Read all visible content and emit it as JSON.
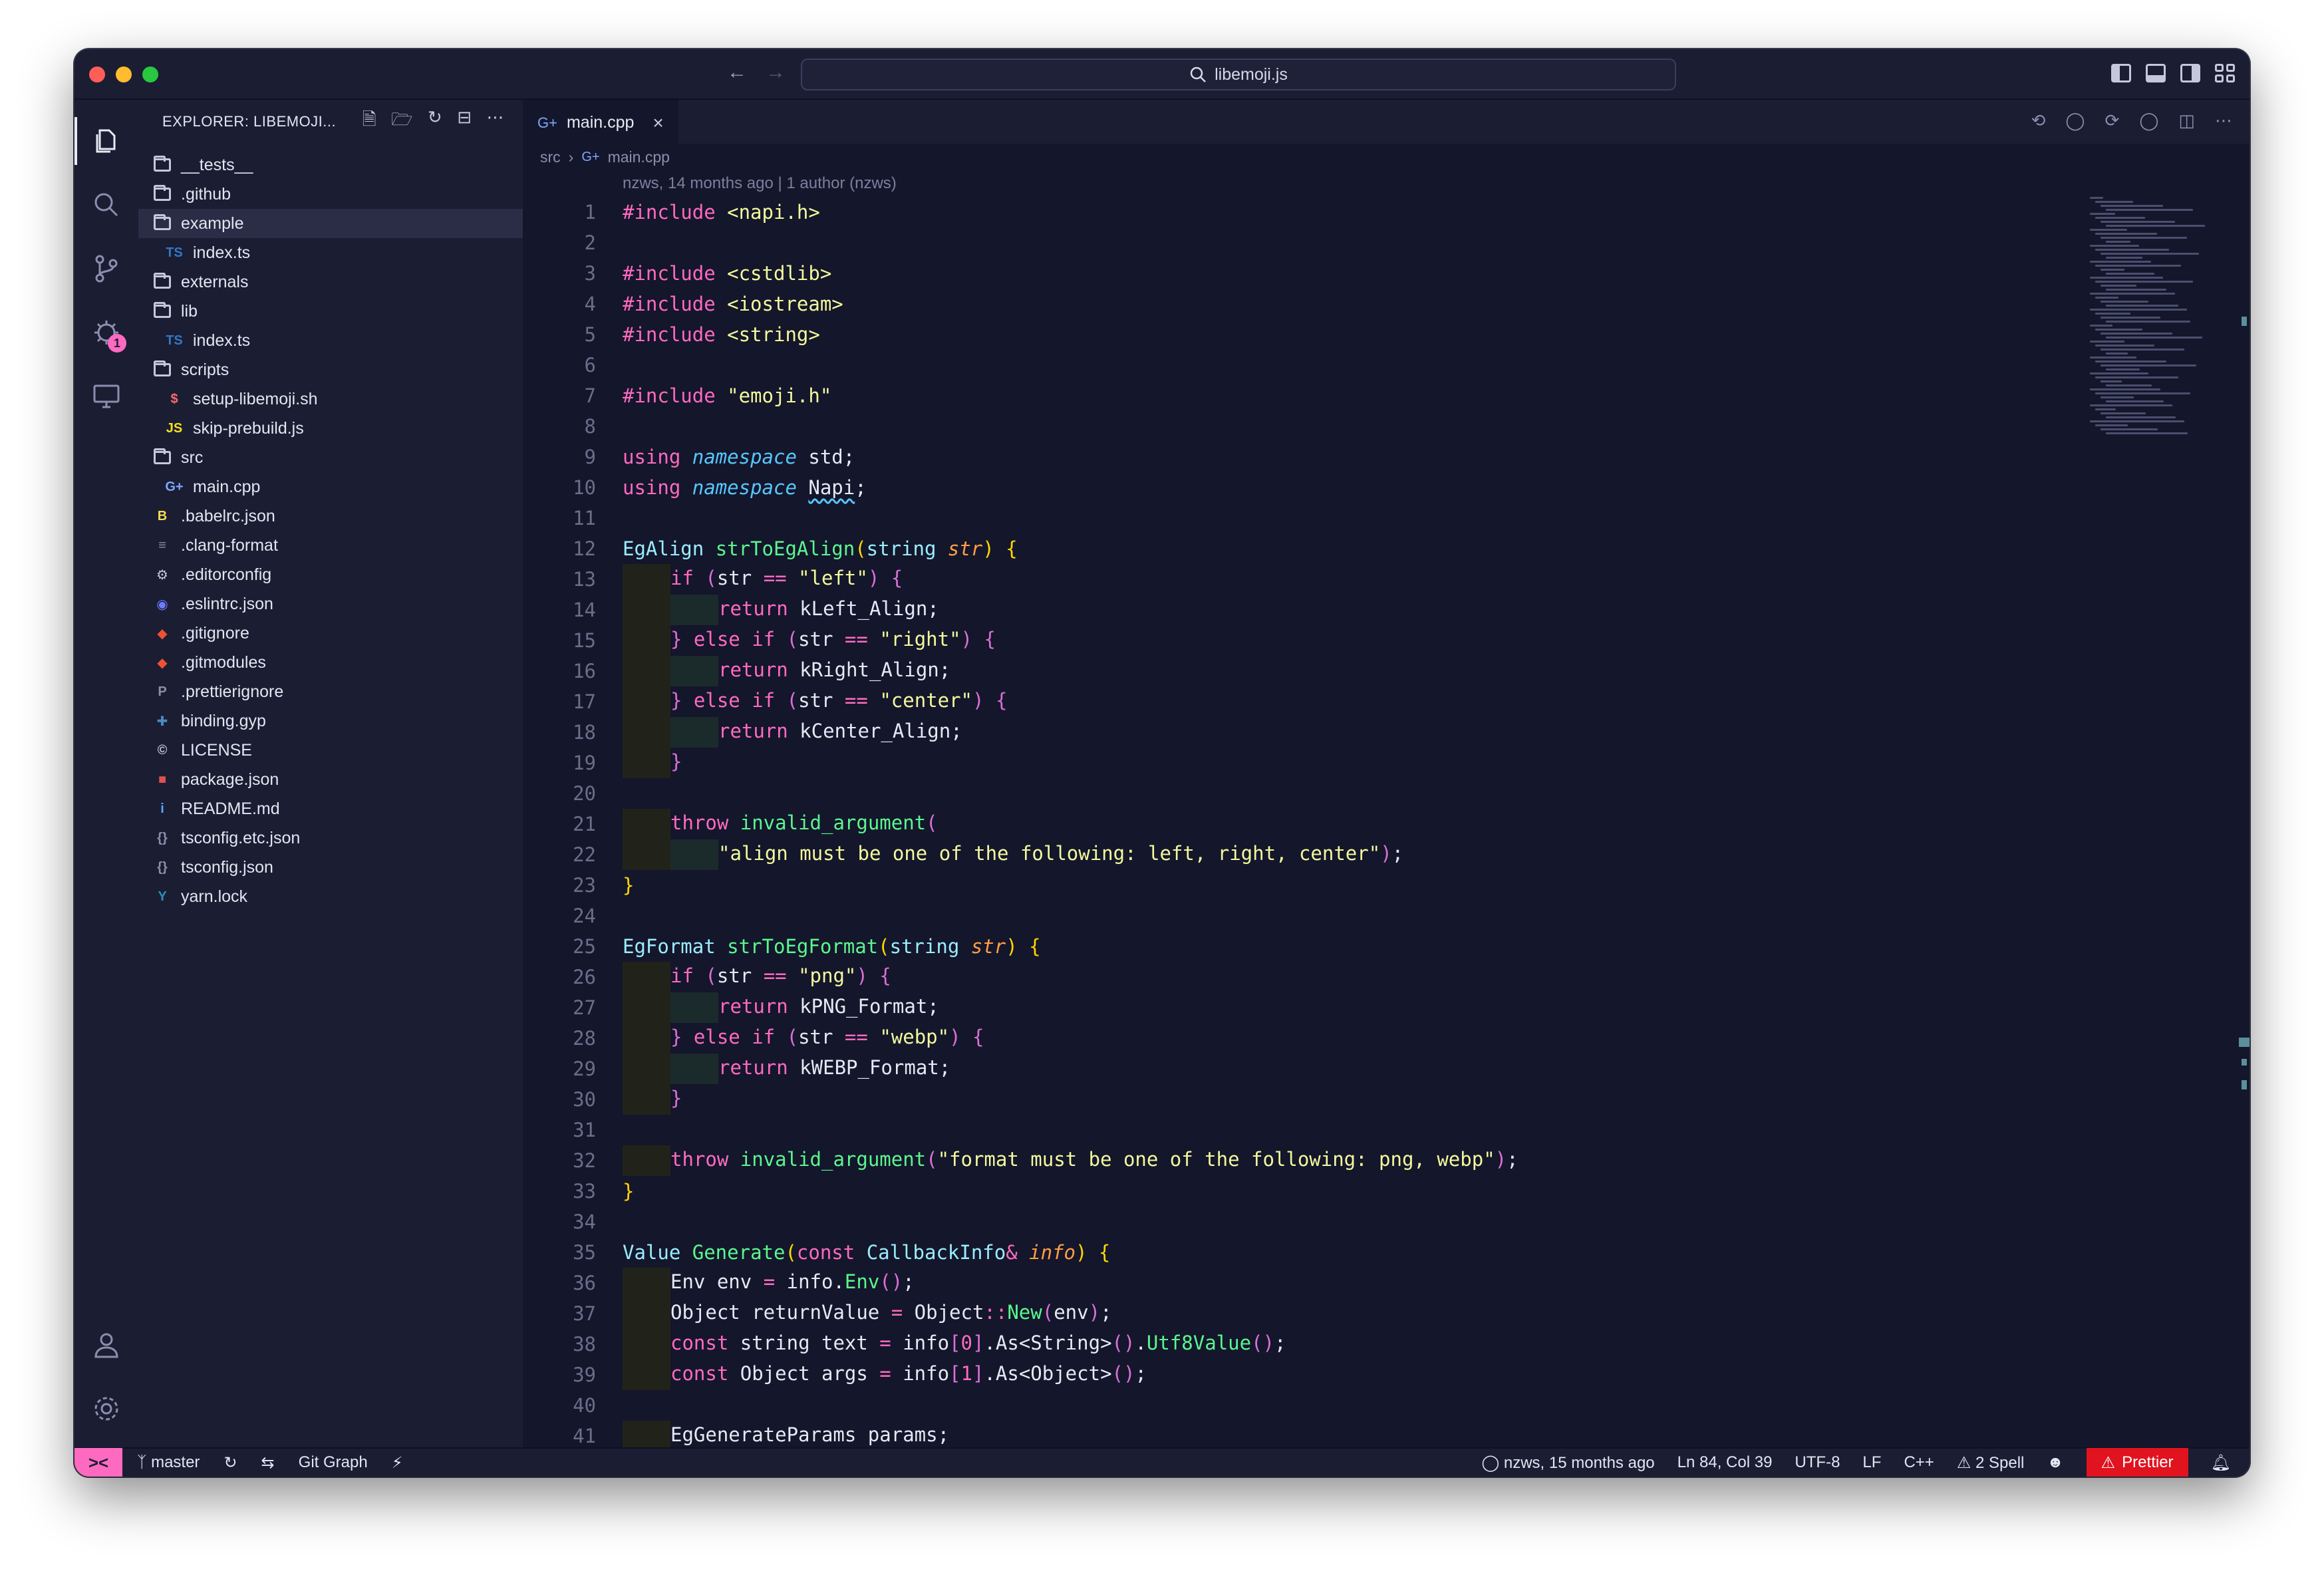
{
  "window": {
    "search_text": "libemoji.js"
  },
  "activity": {
    "extensions_badge": "1"
  },
  "sidebar": {
    "title": "EXPLORER: LIBEMOJI...",
    "tree": [
      {
        "label": "__tests__",
        "icon": "folder-tests-icon",
        "kind": "folder",
        "level": 0
      },
      {
        "label": ".github",
        "icon": "folder-github-icon",
        "kind": "folder",
        "level": 0
      },
      {
        "label": "example",
        "icon": "folder-icon",
        "kind": "folder",
        "level": 0,
        "selected": true
      },
      {
        "label": "index.ts",
        "icon": "typescript-icon",
        "kind": "file",
        "level": 1
      },
      {
        "label": "externals",
        "icon": "folder-icon",
        "kind": "folder",
        "level": 0
      },
      {
        "label": "lib",
        "icon": "folder-icon",
        "kind": "folder",
        "level": 0
      },
      {
        "label": "index.ts",
        "icon": "typescript-icon",
        "kind": "file",
        "level": 1
      },
      {
        "label": "scripts",
        "icon": "folder-icon",
        "kind": "folder",
        "level": 0
      },
      {
        "label": "setup-libemoji.sh",
        "icon": "shell-icon",
        "kind": "file",
        "level": 1
      },
      {
        "label": "skip-prebuild.js",
        "icon": "javascript-icon",
        "kind": "file",
        "level": 1
      },
      {
        "label": "src",
        "icon": "folder-src-icon",
        "kind": "folder",
        "level": 0
      },
      {
        "label": "main.cpp",
        "icon": "cpp-icon",
        "kind": "file",
        "level": 1
      },
      {
        "label": ".babelrc.json",
        "icon": "babel-icon",
        "kind": "file",
        "level": 0
      },
      {
        "label": ".clang-format",
        "icon": "clang-icon",
        "kind": "file",
        "level": 0
      },
      {
        "label": ".editorconfig",
        "icon": "editorconfig-icon",
        "kind": "file",
        "level": 0
      },
      {
        "label": ".eslintrc.json",
        "icon": "eslint-icon",
        "kind": "file",
        "level": 0
      },
      {
        "label": ".gitignore",
        "icon": "git-icon",
        "kind": "file",
        "level": 0
      },
      {
        "label": ".gitmodules",
        "icon": "git-icon",
        "kind": "file",
        "level": 0
      },
      {
        "label": ".prettierignore",
        "icon": "prettier-icon",
        "kind": "file",
        "level": 0
      },
      {
        "label": "binding.gyp",
        "icon": "python-icon",
        "kind": "file",
        "level": 0
      },
      {
        "label": "LICENSE",
        "icon": "license-icon",
        "kind": "file",
        "level": 0
      },
      {
        "label": "package.json",
        "icon": "npm-icon",
        "kind": "file",
        "level": 0
      },
      {
        "label": "README.md",
        "icon": "info-icon",
        "kind": "file",
        "level": 0
      },
      {
        "label": "tsconfig.etc.json",
        "icon": "json-icon",
        "kind": "file",
        "level": 0
      },
      {
        "label": "tsconfig.json",
        "icon": "json-icon",
        "kind": "file",
        "level": 0
      },
      {
        "label": "yarn.lock",
        "icon": "yarn-icon",
        "kind": "file",
        "level": 0
      }
    ]
  },
  "editor": {
    "tab_label": "main.cpp",
    "breadcrumb": [
      "src",
      "main.cpp"
    ],
    "blame": "nzws, 14 months ago | 1 author (nzws)",
    "lines": [
      {
        "n": "1",
        "indent": 0,
        "tokens": [
          [
            "k",
            "#include "
          ],
          [
            "s",
            "<napi.h>"
          ]
        ]
      },
      {
        "n": "2",
        "indent": 0,
        "tokens": []
      },
      {
        "n": "3",
        "indent": 0,
        "tokens": [
          [
            "k",
            "#include "
          ],
          [
            "s",
            "<cstdlib>"
          ]
        ]
      },
      {
        "n": "4",
        "indent": 0,
        "tokens": [
          [
            "k",
            "#include "
          ],
          [
            "s",
            "<iostream>"
          ]
        ]
      },
      {
        "n": "5",
        "indent": 0,
        "tokens": [
          [
            "k",
            "#include "
          ],
          [
            "s",
            "<string>"
          ]
        ]
      },
      {
        "n": "6",
        "indent": 0,
        "tokens": []
      },
      {
        "n": "7",
        "indent": 0,
        "tokens": [
          [
            "k",
            "#include "
          ],
          [
            "s",
            "\"emoji.h\""
          ]
        ]
      },
      {
        "n": "8",
        "indent": 0,
        "tokens": []
      },
      {
        "n": "9",
        "indent": 0,
        "tokens": [
          [
            "k",
            "using "
          ],
          [
            "it",
            "namespace"
          ],
          [
            "p",
            " std;"
          ]
        ]
      },
      {
        "n": "10",
        "indent": 0,
        "tokens": [
          [
            "k",
            "using "
          ],
          [
            "it",
            "namespace"
          ],
          [
            "p",
            " "
          ],
          [
            "u",
            "Napi"
          ],
          [
            "p",
            ";"
          ]
        ]
      },
      {
        "n": "11",
        "indent": 0,
        "tokens": []
      },
      {
        "n": "12",
        "indent": 0,
        "tokens": [
          [
            "t",
            "EgAlign "
          ],
          [
            "f",
            "strToEgAlign"
          ],
          [
            "br1",
            "("
          ],
          [
            "t",
            "string "
          ],
          [
            "pa",
            "str"
          ],
          [
            "br1",
            ")"
          ],
          [
            "p",
            " "
          ],
          [
            "br1",
            "{"
          ]
        ]
      },
      {
        "n": "13",
        "indent": 1,
        "tokens": [
          [
            "k",
            "if "
          ],
          [
            "br2",
            "("
          ],
          [
            "p",
            "str "
          ],
          [
            "k",
            "=="
          ],
          [
            "p",
            " "
          ],
          [
            "s",
            "\"left\""
          ],
          [
            "br2",
            ")"
          ],
          [
            "p",
            " "
          ],
          [
            "br2",
            "{"
          ]
        ]
      },
      {
        "n": "14",
        "indent": 2,
        "tokens": [
          [
            "k",
            "return "
          ],
          [
            "p",
            "kLeft_Align;"
          ]
        ]
      },
      {
        "n": "15",
        "indent": 1,
        "tokens": [
          [
            "br2",
            "}"
          ],
          [
            "k",
            " else if "
          ],
          [
            "br2",
            "("
          ],
          [
            "p",
            "str "
          ],
          [
            "k",
            "=="
          ],
          [
            "p",
            " "
          ],
          [
            "s",
            "\"right\""
          ],
          [
            "br2",
            ")"
          ],
          [
            "p",
            " "
          ],
          [
            "br2",
            "{"
          ]
        ]
      },
      {
        "n": "16",
        "indent": 2,
        "tokens": [
          [
            "k",
            "return "
          ],
          [
            "p",
            "kRight_Align;"
          ]
        ]
      },
      {
        "n": "17",
        "indent": 1,
        "tokens": [
          [
            "br2",
            "}"
          ],
          [
            "k",
            " else if "
          ],
          [
            "br2",
            "("
          ],
          [
            "p",
            "str "
          ],
          [
            "k",
            "=="
          ],
          [
            "p",
            " "
          ],
          [
            "s",
            "\"center\""
          ],
          [
            "br2",
            ")"
          ],
          [
            "p",
            " "
          ],
          [
            "br2",
            "{"
          ]
        ]
      },
      {
        "n": "18",
        "indent": 2,
        "tokens": [
          [
            "k",
            "return "
          ],
          [
            "p",
            "kCenter_Align;"
          ]
        ]
      },
      {
        "n": "19",
        "indent": 1,
        "tokens": [
          [
            "br2",
            "}"
          ]
        ]
      },
      {
        "n": "20",
        "indent": 0,
        "tokens": []
      },
      {
        "n": "21",
        "indent": 1,
        "tokens": [
          [
            "k",
            "throw "
          ],
          [
            "f",
            "invalid_argument"
          ],
          [
            "br2",
            "("
          ]
        ]
      },
      {
        "n": "22",
        "indent": 2,
        "tokens": [
          [
            "s",
            "\"align must be one of the following: left, right, center\""
          ],
          [
            "br2",
            ")"
          ],
          [
            "p",
            ";"
          ]
        ]
      },
      {
        "n": "23",
        "indent": 0,
        "tokens": [
          [
            "br1",
            "}"
          ]
        ]
      },
      {
        "n": "24",
        "indent": 0,
        "tokens": []
      },
      {
        "n": "25",
        "indent": 0,
        "tokens": [
          [
            "t",
            "EgFormat "
          ],
          [
            "f",
            "strToEgFormat"
          ],
          [
            "br1",
            "("
          ],
          [
            "t",
            "string "
          ],
          [
            "pa",
            "str"
          ],
          [
            "br1",
            ")"
          ],
          [
            "p",
            " "
          ],
          [
            "br1",
            "{"
          ]
        ]
      },
      {
        "n": "26",
        "indent": 1,
        "tokens": [
          [
            "k",
            "if "
          ],
          [
            "br2",
            "("
          ],
          [
            "p",
            "str "
          ],
          [
            "k",
            "=="
          ],
          [
            "p",
            " "
          ],
          [
            "s",
            "\"png\""
          ],
          [
            "br2",
            ")"
          ],
          [
            "p",
            " "
          ],
          [
            "br2",
            "{"
          ]
        ]
      },
      {
        "n": "27",
        "indent": 2,
        "tokens": [
          [
            "k",
            "return "
          ],
          [
            "p",
            "kPNG_Format;"
          ]
        ]
      },
      {
        "n": "28",
        "indent": 1,
        "tokens": [
          [
            "br2",
            "}"
          ],
          [
            "k",
            " else if "
          ],
          [
            "br2",
            "("
          ],
          [
            "p",
            "str "
          ],
          [
            "k",
            "=="
          ],
          [
            "p",
            " "
          ],
          [
            "s",
            "\"webp\""
          ],
          [
            "br2",
            ")"
          ],
          [
            "p",
            " "
          ],
          [
            "br2",
            "{"
          ]
        ]
      },
      {
        "n": "29",
        "indent": 2,
        "tokens": [
          [
            "k",
            "return "
          ],
          [
            "p",
            "kWEBP_Format;"
          ]
        ]
      },
      {
        "n": "30",
        "indent": 1,
        "tokens": [
          [
            "br2",
            "}"
          ]
        ]
      },
      {
        "n": "31",
        "indent": 0,
        "tokens": []
      },
      {
        "n": "32",
        "indent": 1,
        "tokens": [
          [
            "k",
            "throw "
          ],
          [
            "f",
            "invalid_argument"
          ],
          [
            "br2",
            "("
          ],
          [
            "s",
            "\"format must be one of the following: png, webp\""
          ],
          [
            "br2",
            ")"
          ],
          [
            "p",
            ";"
          ]
        ]
      },
      {
        "n": "33",
        "indent": 0,
        "tokens": [
          [
            "br1",
            "}"
          ]
        ]
      },
      {
        "n": "34",
        "indent": 0,
        "tokens": []
      },
      {
        "n": "35",
        "indent": 0,
        "tokens": [
          [
            "t",
            "Value "
          ],
          [
            "f",
            "Generate"
          ],
          [
            "br1",
            "("
          ],
          [
            "k",
            "const "
          ],
          [
            "t",
            "CallbackInfo"
          ],
          [
            "k",
            "& "
          ],
          [
            "pa",
            "info"
          ],
          [
            "br1",
            ")"
          ],
          [
            "p",
            " "
          ],
          [
            "br1",
            "{"
          ]
        ]
      },
      {
        "n": "36",
        "indent": 1,
        "tokens": [
          [
            "p",
            "Env env "
          ],
          [
            "k",
            "="
          ],
          [
            "p",
            " info."
          ],
          [
            "f",
            "Env"
          ],
          [
            "br2",
            "()"
          ],
          [
            "p",
            ";"
          ]
        ]
      },
      {
        "n": "37",
        "indent": 1,
        "tokens": [
          [
            "p",
            "Object returnValue "
          ],
          [
            "k",
            "="
          ],
          [
            "p",
            " Object"
          ],
          [
            "k",
            "::"
          ],
          [
            "f",
            "New"
          ],
          [
            "br2",
            "("
          ],
          [
            "p",
            "env"
          ],
          [
            "br2",
            ")"
          ],
          [
            "p",
            ";"
          ]
        ]
      },
      {
        "n": "38",
        "indent": 1,
        "tokens": [
          [
            "k",
            "const "
          ],
          [
            "p",
            "string text "
          ],
          [
            "k",
            "="
          ],
          [
            "p",
            " info"
          ],
          [
            "br2",
            "["
          ],
          [
            "k",
            "0"
          ],
          [
            "br2",
            "]"
          ],
          [
            "p",
            ".As<String>"
          ],
          [
            "br2",
            "()"
          ],
          [
            "p",
            "."
          ],
          [
            "f",
            "Utf8Value"
          ],
          [
            "br2",
            "()"
          ],
          [
            "p",
            ";"
          ]
        ]
      },
      {
        "n": "39",
        "indent": 1,
        "tokens": [
          [
            "k",
            "const "
          ],
          [
            "p",
            "Object args "
          ],
          [
            "k",
            "="
          ],
          [
            "p",
            " info"
          ],
          [
            "br2",
            "["
          ],
          [
            "k",
            "1"
          ],
          [
            "br2",
            "]"
          ],
          [
            "p",
            ".As<Object>"
          ],
          [
            "br2",
            "()"
          ],
          [
            "p",
            ";"
          ]
        ]
      },
      {
        "n": "40",
        "indent": 0,
        "tokens": []
      },
      {
        "n": "41",
        "indent": 1,
        "tokens": [
          [
            "p",
            "EgGenerateParams params;"
          ]
        ]
      }
    ]
  },
  "statusbar": {
    "branch": "master",
    "git_graph": "Git Graph",
    "blame": "nzws, 15 months ago",
    "cursor": "Ln 84, Col 39",
    "encoding": "UTF-8",
    "eol": "LF",
    "language": "C++",
    "spell": "2 Spell",
    "prettier": "Prettier"
  },
  "colors": {
    "background": "#14162b",
    "keyword": "#ff6ac1",
    "string": "#f3f99d",
    "function": "#5af78e",
    "type": "#9aedfe",
    "remote_button": "#ff6ac1",
    "prettier_error": "#e0131f"
  }
}
